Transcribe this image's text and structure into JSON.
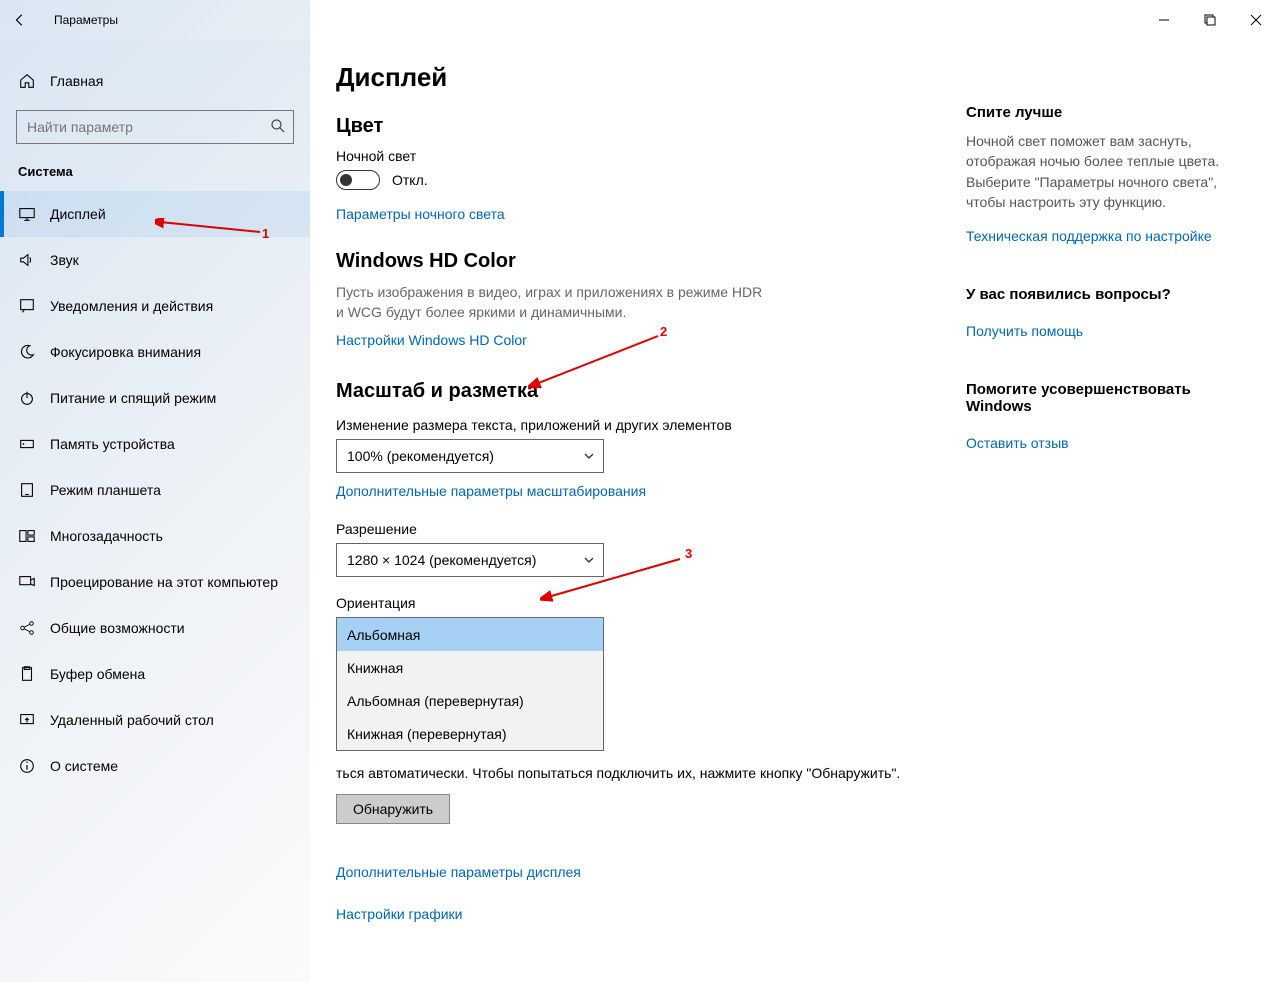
{
  "app": {
    "title": "Параметры"
  },
  "sidebar": {
    "home": "Главная",
    "search_placeholder": "Найти параметр",
    "category": "Система",
    "items": [
      {
        "label": "Дисплей"
      },
      {
        "label": "Звук"
      },
      {
        "label": "Уведомления и действия"
      },
      {
        "label": "Фокусировка внимания"
      },
      {
        "label": "Питание и спящий режим"
      },
      {
        "label": "Память устройства"
      },
      {
        "label": "Режим планшета"
      },
      {
        "label": "Многозадачность"
      },
      {
        "label": "Проецирование на этот компьютер"
      },
      {
        "label": "Общие возможности"
      },
      {
        "label": "Буфер обмена"
      },
      {
        "label": "Удаленный рабочий стол"
      },
      {
        "label": "О системе"
      }
    ]
  },
  "page": {
    "title": "Дисплей",
    "color_h": "Цвет",
    "nightlight_label": "Ночной свет",
    "nightlight_state": "Откл.",
    "nightlight_link": "Параметры ночного света",
    "hdcolor_h": "Windows HD Color",
    "hdcolor_text": "Пусть изображения в видео, играх и приложениях в режиме HDR и WCG будут более яркими и динамичными.",
    "hdcolor_link": "Настройки Windows HD Color",
    "scale_h": "Масштаб и разметка",
    "scale_label": "Изменение размера текста, приложений и других элементов",
    "scale_value": "100% (рекомендуется)",
    "scale_link": "Дополнительные параметры масштабирования",
    "resolution_label": "Разрешение",
    "resolution_value": "1280 × 1024 (рекомендуется)",
    "orientation_label": "Ориентация",
    "orientation_options": [
      "Альбомная",
      "Книжная",
      "Альбомная (перевернутая)",
      "Книжная (перевернутая)"
    ],
    "detect_text_partial": "ться автоматически. Чтобы попытаться подключить их, нажмите кнопку \"Обнаружить\".",
    "detect_btn": "Обнаружить",
    "adv_display_link": "Дополнительные параметры дисплея",
    "graphics_link": "Настройки графики"
  },
  "aside": {
    "sleep_h": "Спите лучше",
    "sleep_text": "Ночной свет поможет вам заснуть, отображая ночью более теплые цвета. Выберите \"Параметры ночного света\", чтобы настроить эту функцию.",
    "sleep_link": "Техническая поддержка по настройке",
    "help_h": "У вас появились вопросы?",
    "help_link": "Получить помощь",
    "feedback_h": "Помогите усовершенствовать Windows",
    "feedback_link": "Оставить отзыв"
  },
  "annotations": {
    "n1": "1",
    "n2": "2",
    "n3": "3"
  }
}
